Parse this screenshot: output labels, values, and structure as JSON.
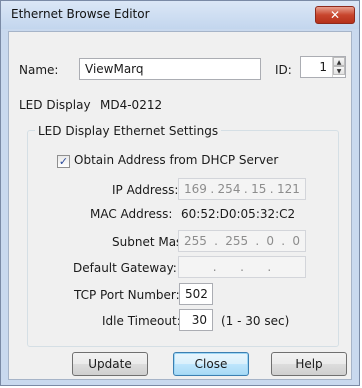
{
  "window": {
    "title": "Ethernet Browse Editor",
    "close_glyph": "✕"
  },
  "form": {
    "name_label": "Name:",
    "name_value": "ViewMarq",
    "id_label": "ID:",
    "id_value": "1",
    "led_display_label": "LED Display",
    "led_display_value": "MD4-0212"
  },
  "group": {
    "title": "LED Display Ethernet Settings",
    "dhcp_label": "Obtain Address from DHCP Server",
    "dhcp_checked": true,
    "ip_label": "IP Address:",
    "ip_octets": [
      "169",
      "254",
      "15",
      "121"
    ],
    "mac_label": "MAC Address:",
    "mac_value": "60:52:D0:05:32:C2",
    "subnet_label": "Subnet Mask:",
    "subnet_octets": [
      "255",
      "255",
      "0",
      "0"
    ],
    "gateway_label": "Default Gateway:",
    "gateway_octets": [
      "",
      "",
      "",
      ""
    ],
    "tcp_label": "TCP Port Number:",
    "tcp_value": "502",
    "idle_label": "Idle Timeout:",
    "idle_value": "30",
    "idle_range": "(1 - 30 sec)"
  },
  "buttons": {
    "update": "Update",
    "close": "Close",
    "help": "Help"
  }
}
